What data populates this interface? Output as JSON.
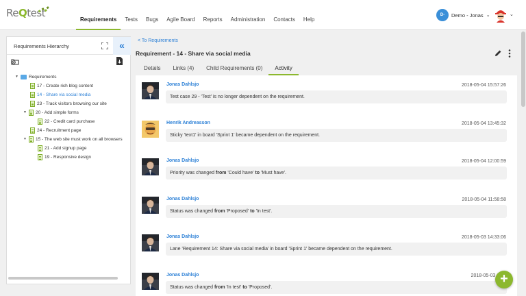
{
  "app": {
    "logo_prefix": "Re",
    "logo_q": "Q",
    "logo_suffix": "test"
  },
  "nav": {
    "items": [
      {
        "label": "Requirements"
      },
      {
        "label": "Tests"
      },
      {
        "label": "Bugs"
      },
      {
        "label": "Agile Board"
      },
      {
        "label": "Reports"
      },
      {
        "label": "Administration"
      },
      {
        "label": "Contacts"
      },
      {
        "label": "Help"
      }
    ],
    "active": "Requirements"
  },
  "user": {
    "initials": "D-",
    "name": "Demo - Jonas"
  },
  "sidebar": {
    "title": "Requirements Hierarchy",
    "collapse_glyph": "«",
    "tree": [
      {
        "label": "Requirements",
        "type": "folder",
        "toggle": "▼"
      },
      {
        "label": "17 - Create rich blog content",
        "type": "doc",
        "toggle": ""
      },
      {
        "label": "14 - Share via social media",
        "type": "doc",
        "toggle": "",
        "selected": true
      },
      {
        "label": "23 - Track visitors browsing our site",
        "type": "doc",
        "toggle": ""
      },
      {
        "label": "20 - Add simple forms",
        "type": "doc",
        "toggle": "▼"
      },
      {
        "label": "22 - Credit card purchase",
        "type": "doc",
        "toggle": ""
      },
      {
        "label": "24 - Recruitment page",
        "type": "doc",
        "toggle": ""
      },
      {
        "label": "15 - The web site must work on all browsers",
        "type": "doc",
        "toggle": "▼"
      },
      {
        "label": "21 - Add signup page",
        "type": "doc",
        "toggle": ""
      },
      {
        "label": "19 - Responsive design",
        "type": "doc",
        "toggle": ""
      }
    ]
  },
  "main": {
    "back_link": "< To Requirements",
    "title": "Requirement - 14 - Share via social media",
    "tabs": [
      {
        "label": "Details"
      },
      {
        "label": "Links (4)"
      },
      {
        "label": "Child Requirements (0)"
      },
      {
        "label": "Activity"
      }
    ],
    "active_tab": "Activity",
    "activity": [
      {
        "author": "Jonas Dahlsjo",
        "timestamp": "2018-05-04 15:57:26",
        "avatar": "jonas",
        "message": [
          {
            "t": "Test case 29 - 'Test' is no longer dependent on the requirement.",
            "b": false
          }
        ]
      },
      {
        "author": "Henrik Andreasson",
        "timestamp": "2018-05-04 13:45:32",
        "avatar": "henrik",
        "message": [
          {
            "t": "Sticky 'text1' in board 'Sprint 1' became dependent on the requirement.",
            "b": false
          }
        ]
      },
      {
        "author": "Jonas Dahlsjo",
        "timestamp": "2018-05-04 12:00:59",
        "avatar": "jonas",
        "message": [
          {
            "t": "Priority was changed ",
            "b": false
          },
          {
            "t": "from",
            "b": true
          },
          {
            "t": " 'Could have' ",
            "b": false
          },
          {
            "t": "to",
            "b": true
          },
          {
            "t": " 'Must have'.",
            "b": false
          }
        ]
      },
      {
        "author": "Jonas Dahlsjo",
        "timestamp": "2018-05-04 11:58:58",
        "avatar": "jonas",
        "message": [
          {
            "t": "Status was changed ",
            "b": false
          },
          {
            "t": "from",
            "b": true
          },
          {
            "t": " 'Proposed' ",
            "b": false
          },
          {
            "t": "to",
            "b": true
          },
          {
            "t": " 'In test'.",
            "b": false
          }
        ]
      },
      {
        "author": "Jonas Dahlsjo",
        "timestamp": "2018-05-03 14:33:06",
        "avatar": "jonas",
        "message": [
          {
            "t": "Lane 'Requirement 14: Share via social media' in board 'Sprint 1' became dependent on the requirement.",
            "b": false
          }
        ]
      },
      {
        "author": "Jonas Dahlsjo",
        "timestamp": "2018-05-03 14:3",
        "avatar": "jonas",
        "message": [
          {
            "t": "Status was changed ",
            "b": false
          },
          {
            "t": "from",
            "b": true
          },
          {
            "t": " 'In test' ",
            "b": false
          },
          {
            "t": "to",
            "b": true
          },
          {
            "t": " 'Proposed'.",
            "b": false
          }
        ]
      }
    ],
    "fab_glyph": "+"
  },
  "colors": {
    "accent_green": "#8cb82e",
    "link_blue": "#2a7fd6",
    "badge_blue": "#3a8fd8"
  },
  "icons": [
    "expand-icon",
    "collapse-icon",
    "add-folder-icon",
    "export-icon",
    "folder-icon",
    "document-icon",
    "pencil-icon",
    "more-vertical-icon",
    "plus-icon",
    "chevron-down-icon"
  ]
}
